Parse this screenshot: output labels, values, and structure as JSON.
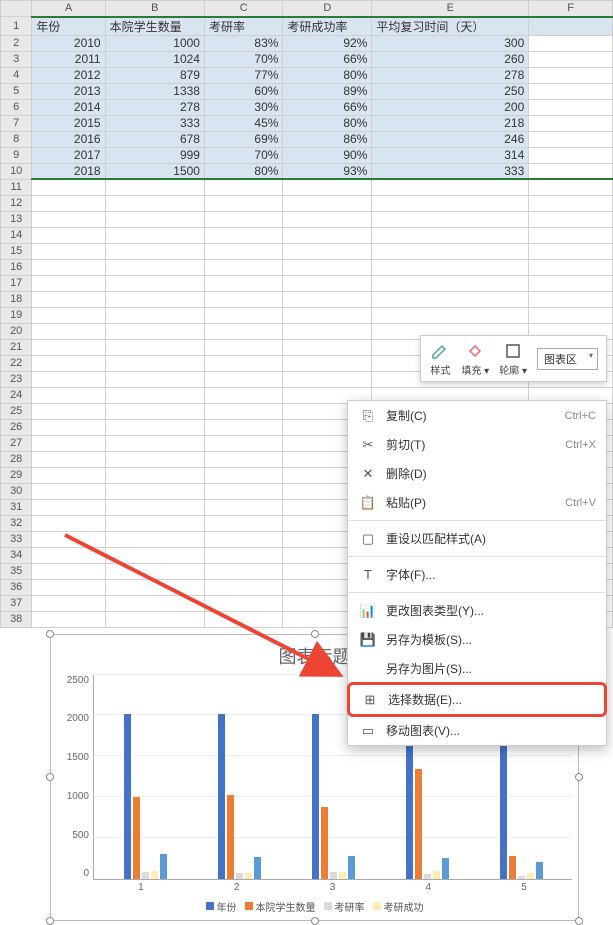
{
  "columns": [
    "A",
    "B",
    "C",
    "D",
    "E",
    "F"
  ],
  "headers": [
    "年份",
    "本院学生数量",
    "考研率",
    "考研成功率",
    "平均复习时间（天）"
  ],
  "rows": [
    {
      "n": 2,
      "a": "2010",
      "b": "1000",
      "c": "83%",
      "d": "92%",
      "e": "300"
    },
    {
      "n": 3,
      "a": "2011",
      "b": "1024",
      "c": "70%",
      "d": "66%",
      "e": "260"
    },
    {
      "n": 4,
      "a": "2012",
      "b": "879",
      "c": "77%",
      "d": "80%",
      "e": "278"
    },
    {
      "n": 5,
      "a": "2013",
      "b": "1338",
      "c": "60%",
      "d": "89%",
      "e": "250"
    },
    {
      "n": 6,
      "a": "2014",
      "b": "278",
      "c": "30%",
      "d": "66%",
      "e": "200"
    },
    {
      "n": 7,
      "a": "2015",
      "b": "333",
      "c": "45%",
      "d": "80%",
      "e": "218"
    },
    {
      "n": 8,
      "a": "2016",
      "b": "678",
      "c": "69%",
      "d": "86%",
      "e": "246"
    },
    {
      "n": 9,
      "a": "2017",
      "b": "999",
      "c": "70%",
      "d": "90%",
      "e": "314"
    },
    {
      "n": 10,
      "a": "2018",
      "b": "1500",
      "c": "80%",
      "d": "93%",
      "e": "333"
    }
  ],
  "empty_rows": [
    11,
    12,
    13,
    14,
    15,
    16,
    17,
    18,
    19,
    20,
    21,
    22,
    23,
    24,
    25,
    26,
    27,
    28,
    29,
    30,
    31,
    32,
    33,
    34,
    35,
    36,
    37,
    38
  ],
  "chart_data": {
    "type": "bar",
    "title": "图表标题",
    "yticks": [
      "2500",
      "2000",
      "1500",
      "1000",
      "500",
      "0"
    ],
    "ymax": 2500,
    "categories": [
      "1",
      "2",
      "3",
      "4",
      "5"
    ],
    "series": [
      {
        "name": "年份",
        "color": "c-blue",
        "values": [
          2010,
          2011,
          2012,
          2013,
          2014
        ]
      },
      {
        "name": "本院学生数量",
        "color": "c-red",
        "values": [
          1000,
          1024,
          879,
          1338,
          278
        ]
      },
      {
        "name": "考研率",
        "color": "c-gray",
        "values": [
          83,
          70,
          77,
          60,
          30
        ]
      },
      {
        "name": "考研成功率",
        "color": "c-yellow",
        "values": [
          92,
          66,
          80,
          89,
          66
        ]
      },
      {
        "name": "平均复习时间（天）",
        "color": "c-dblue",
        "values": [
          300,
          260,
          278,
          250,
          200
        ]
      }
    ],
    "legend_visible": [
      "年份",
      "本院学生数量",
      "考研率",
      "考研成功"
    ]
  },
  "toolbar": {
    "style": "样式",
    "fill": "填充",
    "outline": "轮廓",
    "chartarea": "图表区"
  },
  "menu": {
    "copy": "复制(C)",
    "copy_sc": "Ctrl+C",
    "cut": "剪切(T)",
    "cut_sc": "Ctrl+X",
    "delete": "删除(D)",
    "paste": "粘贴(P)",
    "paste_sc": "Ctrl+V",
    "reset_style": "重设以匹配样式(A)",
    "font": "字体(F)...",
    "change_type": "更改图表类型(Y)...",
    "save_template": "另存为模板(S)...",
    "save_image": "另存为图片(S)...",
    "select_data": "选择数据(E)...",
    "move_chart": "移动图表(V)..."
  }
}
